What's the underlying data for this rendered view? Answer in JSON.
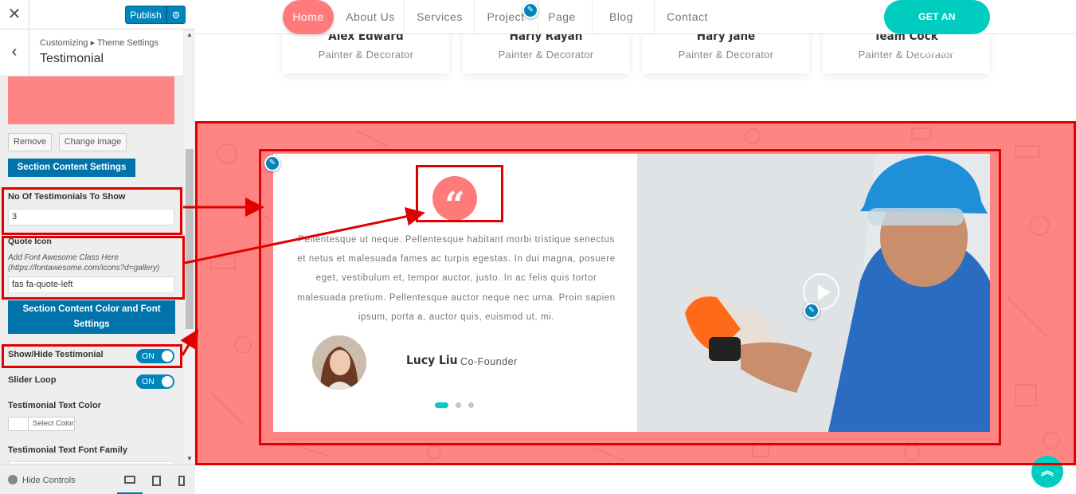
{
  "customizer": {
    "close_icon": "close-icon",
    "publish_label": "Publish",
    "settings_icon": "gear-icon",
    "back_icon": "chevron-left-icon",
    "breadcrumb": "Customizing ▸ Theme Settings",
    "section_title": "Testimonial",
    "image_preview_color": "#ff8585",
    "remove_label": "Remove",
    "change_image_label": "Change image",
    "section_content_settings_label": "Section Content Settings",
    "num_testimonials_label": "No Of Testimonials To Show",
    "num_testimonials_value": "3",
    "quote_icon_label": "Quote Icon",
    "quote_icon_desc": "Add Font Awesome Class Here (https://fontawesome.com/icons?d=gallery)",
    "quote_icon_value": "fas fa-quote-left",
    "color_font_settings_label": "Section Content Color and Font Settings",
    "show_hide_label": "Show/Hide Testimonial",
    "show_hide_state": "ON",
    "slider_loop_label": "Slider Loop",
    "slider_loop_state": "ON",
    "text_color_label": "Testimonial Text Color",
    "select_color_label": "Select Color",
    "text_font_label": "Testimonial Text Font Family",
    "hide_controls_label": "Hide Controls",
    "devices": [
      "desktop-icon",
      "tablet-icon",
      "mobile-icon"
    ],
    "accent_color": "#0085ba"
  },
  "preview": {
    "nav": {
      "items": [
        "Home",
        "About Us",
        "Services",
        "Project",
        "Page",
        "Blog",
        "Contact"
      ],
      "active": "Home",
      "appointment_label": "GET AN APPOINTMENT"
    },
    "team": [
      {
        "name": "Alex Edward",
        "role": "Painter & Decorator"
      },
      {
        "name": "Harly Rayan",
        "role": "Painter & Decorator"
      },
      {
        "name": "Hary Jane",
        "role": "Painter & Decorator"
      },
      {
        "name": "Team Cock",
        "role": "Painter & Decorator"
      }
    ],
    "testimonial": {
      "quote_icon": "quote-left-icon",
      "text": "Pellentesque ut neque. Pellentesque habitant morbi tristique senectus et netus et malesuada fames ac turpis egestas. In dui magna, posuere eget, vestibulum et, tempor auctor, justo. In ac felis quis tortor malesuada pretium. Pellentesque auctor neque nec urna. Proin sapien ipsum, porta a, auctor quis, euismod ut, mi.",
      "author_name": "Lucy Liu",
      "author_role": "Co-Founder",
      "slides": 3,
      "active_slide": 1,
      "section_color": "#ff8585",
      "video_icon": "play-icon"
    },
    "scroll_top_icon": "double-chevron-up-icon",
    "brand_colors": {
      "primary": "#ff7a7a",
      "secondary": "#00cdc0"
    }
  }
}
